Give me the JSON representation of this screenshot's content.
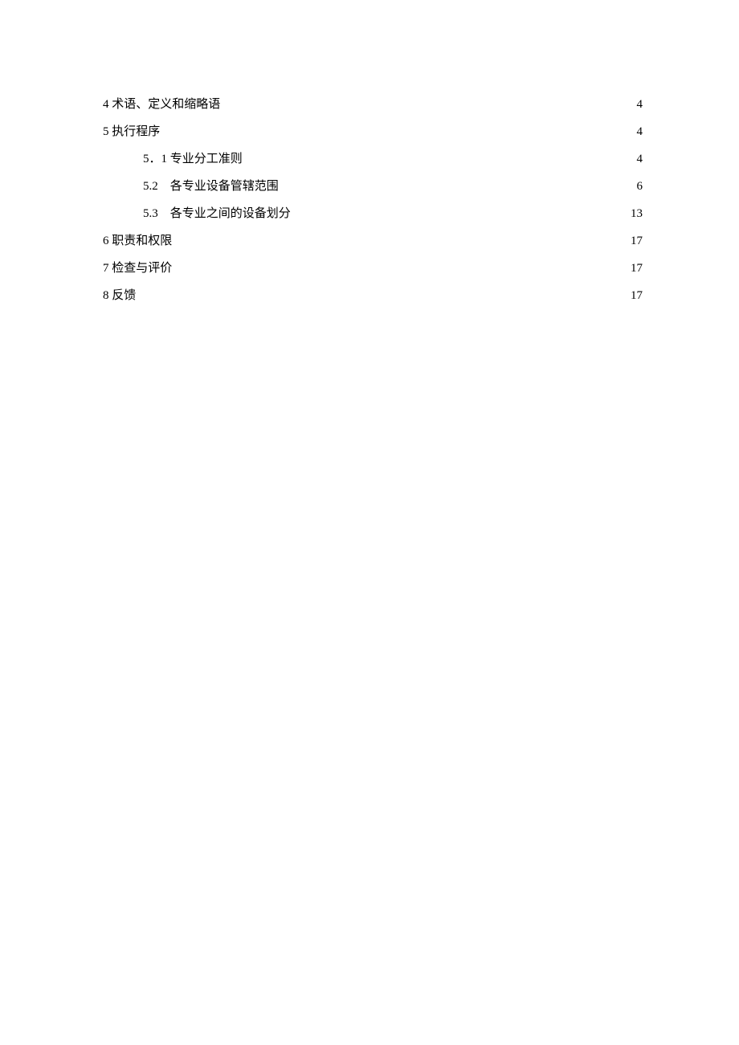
{
  "toc": {
    "entries": [
      {
        "label": "4 术语、定义和缩略语",
        "page": "4",
        "indent": false
      },
      {
        "label": "5 执行程序",
        "page": "4",
        "indent": false
      },
      {
        "label": "5．1 专业分工准则",
        "page": "4",
        "indent": true
      },
      {
        "label": "5.2　各专业设备管辖范围",
        "page": "6",
        "indent": true
      },
      {
        "label": "5.3　各专业之间的设备划分",
        "page": "13",
        "indent": true
      },
      {
        "label": "6 职责和权限",
        "page": "17",
        "indent": false
      },
      {
        "label": "7 检查与评价",
        "page": "17",
        "indent": false
      },
      {
        "label": "8 反馈",
        "page": "17",
        "indent": false
      }
    ]
  }
}
